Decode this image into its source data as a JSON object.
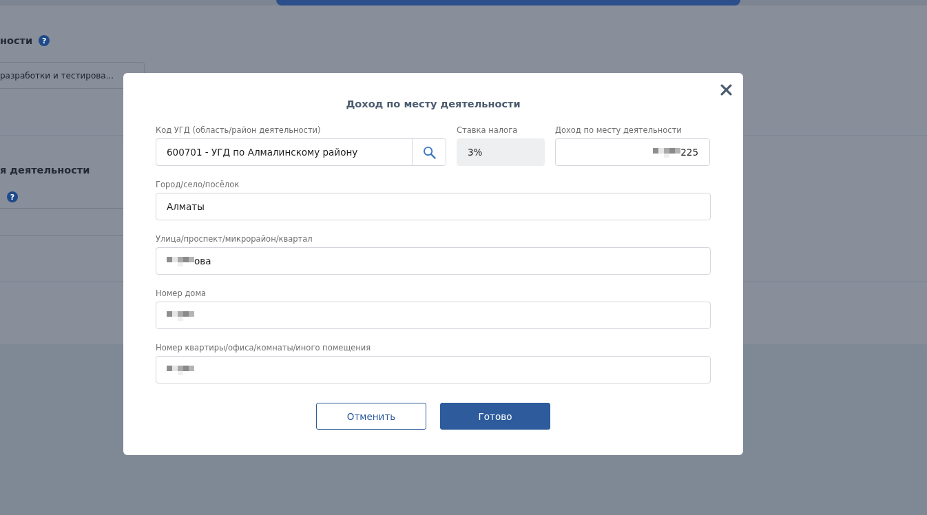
{
  "background": {
    "sections": [
      {
        "heading": "ности",
        "help": "?",
        "field": {
          "kind": "select",
          "value": "разработки и тестирова..."
        }
      },
      {
        "heading": "я деятельности",
        "field": {
          "kind": "input",
          "help": "?"
        }
      }
    ]
  },
  "dialog": {
    "title": "Доход по месту деятельности",
    "rows": [
      {
        "fields": [
          {
            "kind": "lookup",
            "label": "Код УГД (область/район деятельности)",
            "value": "600701 - УГД по Алмалинскому району"
          },
          {
            "kind": "readonly",
            "label": "Ставка налога",
            "value": "3%"
          },
          {
            "kind": "amount",
            "label": "Доход по месту деятельности",
            "value": "225",
            "redacted": true
          }
        ]
      },
      {
        "fields": [
          {
            "kind": "text",
            "label": "Город/село/посёлок",
            "value": "Алматы"
          }
        ]
      },
      {
        "fields": [
          {
            "kind": "text",
            "label": "Улица/проспект/микрорайон/квартал",
            "value": "ова",
            "redacted": true
          }
        ]
      },
      {
        "fields": [
          {
            "kind": "text",
            "label": "Номер дома",
            "redacted": true
          }
        ]
      },
      {
        "fields": [
          {
            "kind": "text",
            "label": "Номер квартиры/офиса/комнаты/иного помещения",
            "redacted": true
          }
        ]
      }
    ],
    "buttons": [
      {
        "kind": "secondary",
        "label": "Отменить"
      },
      {
        "kind": "primary",
        "label": "Готово"
      }
    ]
  }
}
